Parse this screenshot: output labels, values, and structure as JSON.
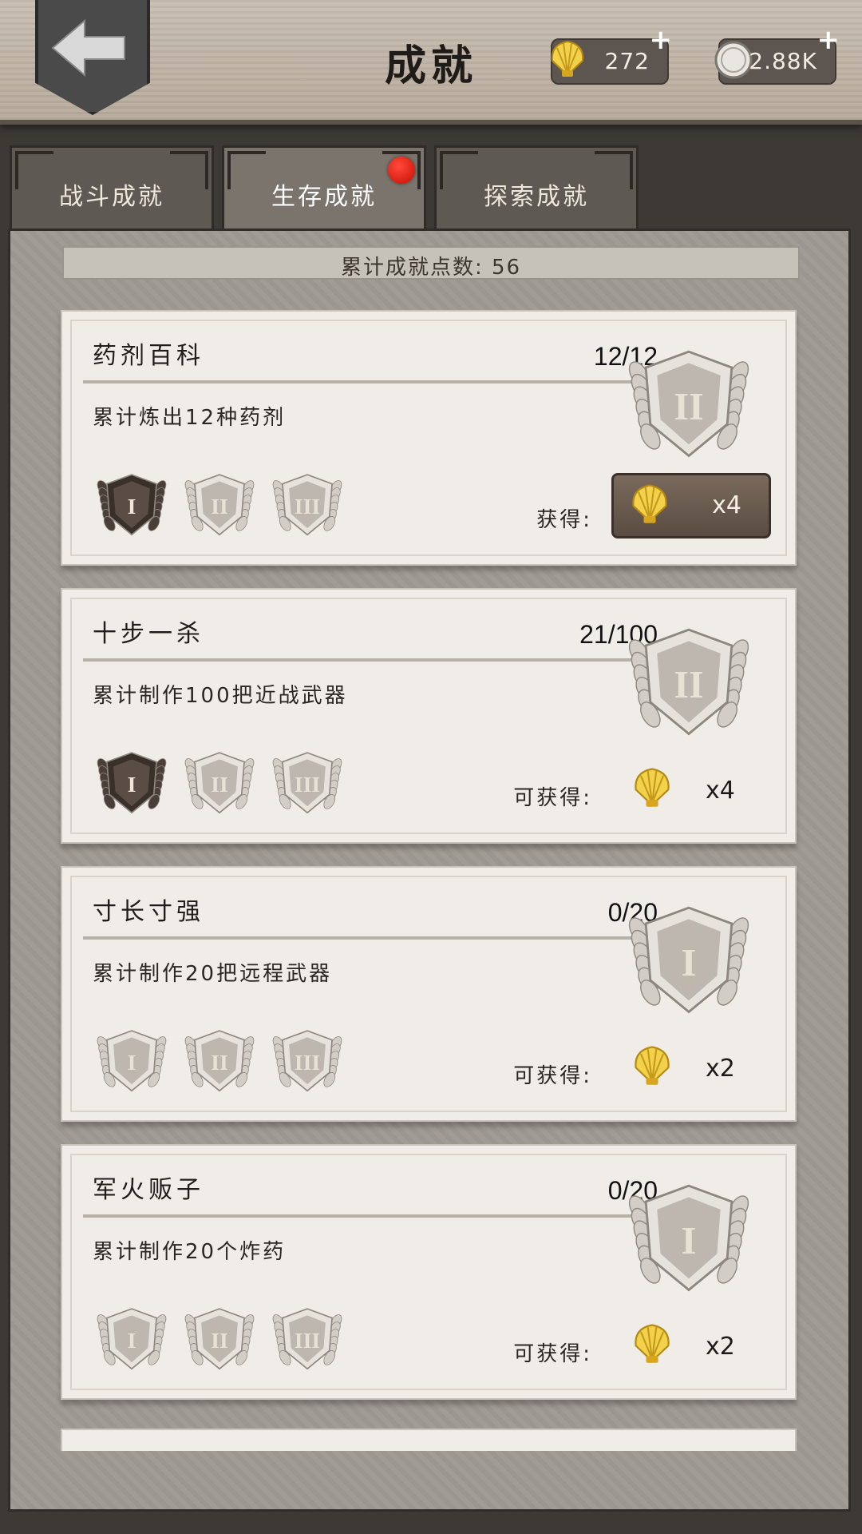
{
  "header": {
    "title": "成就",
    "shells": "272",
    "coins": "2.88K",
    "plus": "+"
  },
  "tabs": [
    {
      "label": "战斗成就",
      "active": false
    },
    {
      "label": "生存成就",
      "active": true,
      "badge": true
    },
    {
      "label": "探索成就",
      "active": false
    }
  ],
  "points_text": "累计成就点数: 56",
  "achievements": [
    {
      "name": "药剂百科",
      "progress": "12/12",
      "desc": "累计炼出12种药剂",
      "big_medal": "II",
      "tiers_earned": 1,
      "reward_label": "获得:",
      "reward_count": "x4",
      "claimable": true
    },
    {
      "name": "十步一杀",
      "progress": "21/100",
      "desc": "累计制作100把近战武器",
      "big_medal": "II",
      "tiers_earned": 1,
      "reward_label": "可获得:",
      "reward_count": "x4",
      "claimable": false
    },
    {
      "name": "寸长寸强",
      "progress": "0/20",
      "desc": "累计制作20把远程武器",
      "big_medal": "I",
      "tiers_earned": 0,
      "reward_label": "可获得:",
      "reward_count": "x2",
      "claimable": false
    },
    {
      "name": "军火贩子",
      "progress": "0/20",
      "desc": "累计制作20个炸药",
      "big_medal": "I",
      "tiers_earned": 0,
      "reward_label": "可获得:",
      "reward_count": "x2",
      "claimable": false
    }
  ],
  "icons": {
    "back": "back-arrow-icon",
    "shell": "shell-icon",
    "coin": "coin-icon",
    "medal": "laurel-medal-icon"
  },
  "colors": {
    "badge_red": "#d81a0c",
    "medal_silver": "#c8c3bc",
    "medal_dark": "#5a4d45"
  }
}
